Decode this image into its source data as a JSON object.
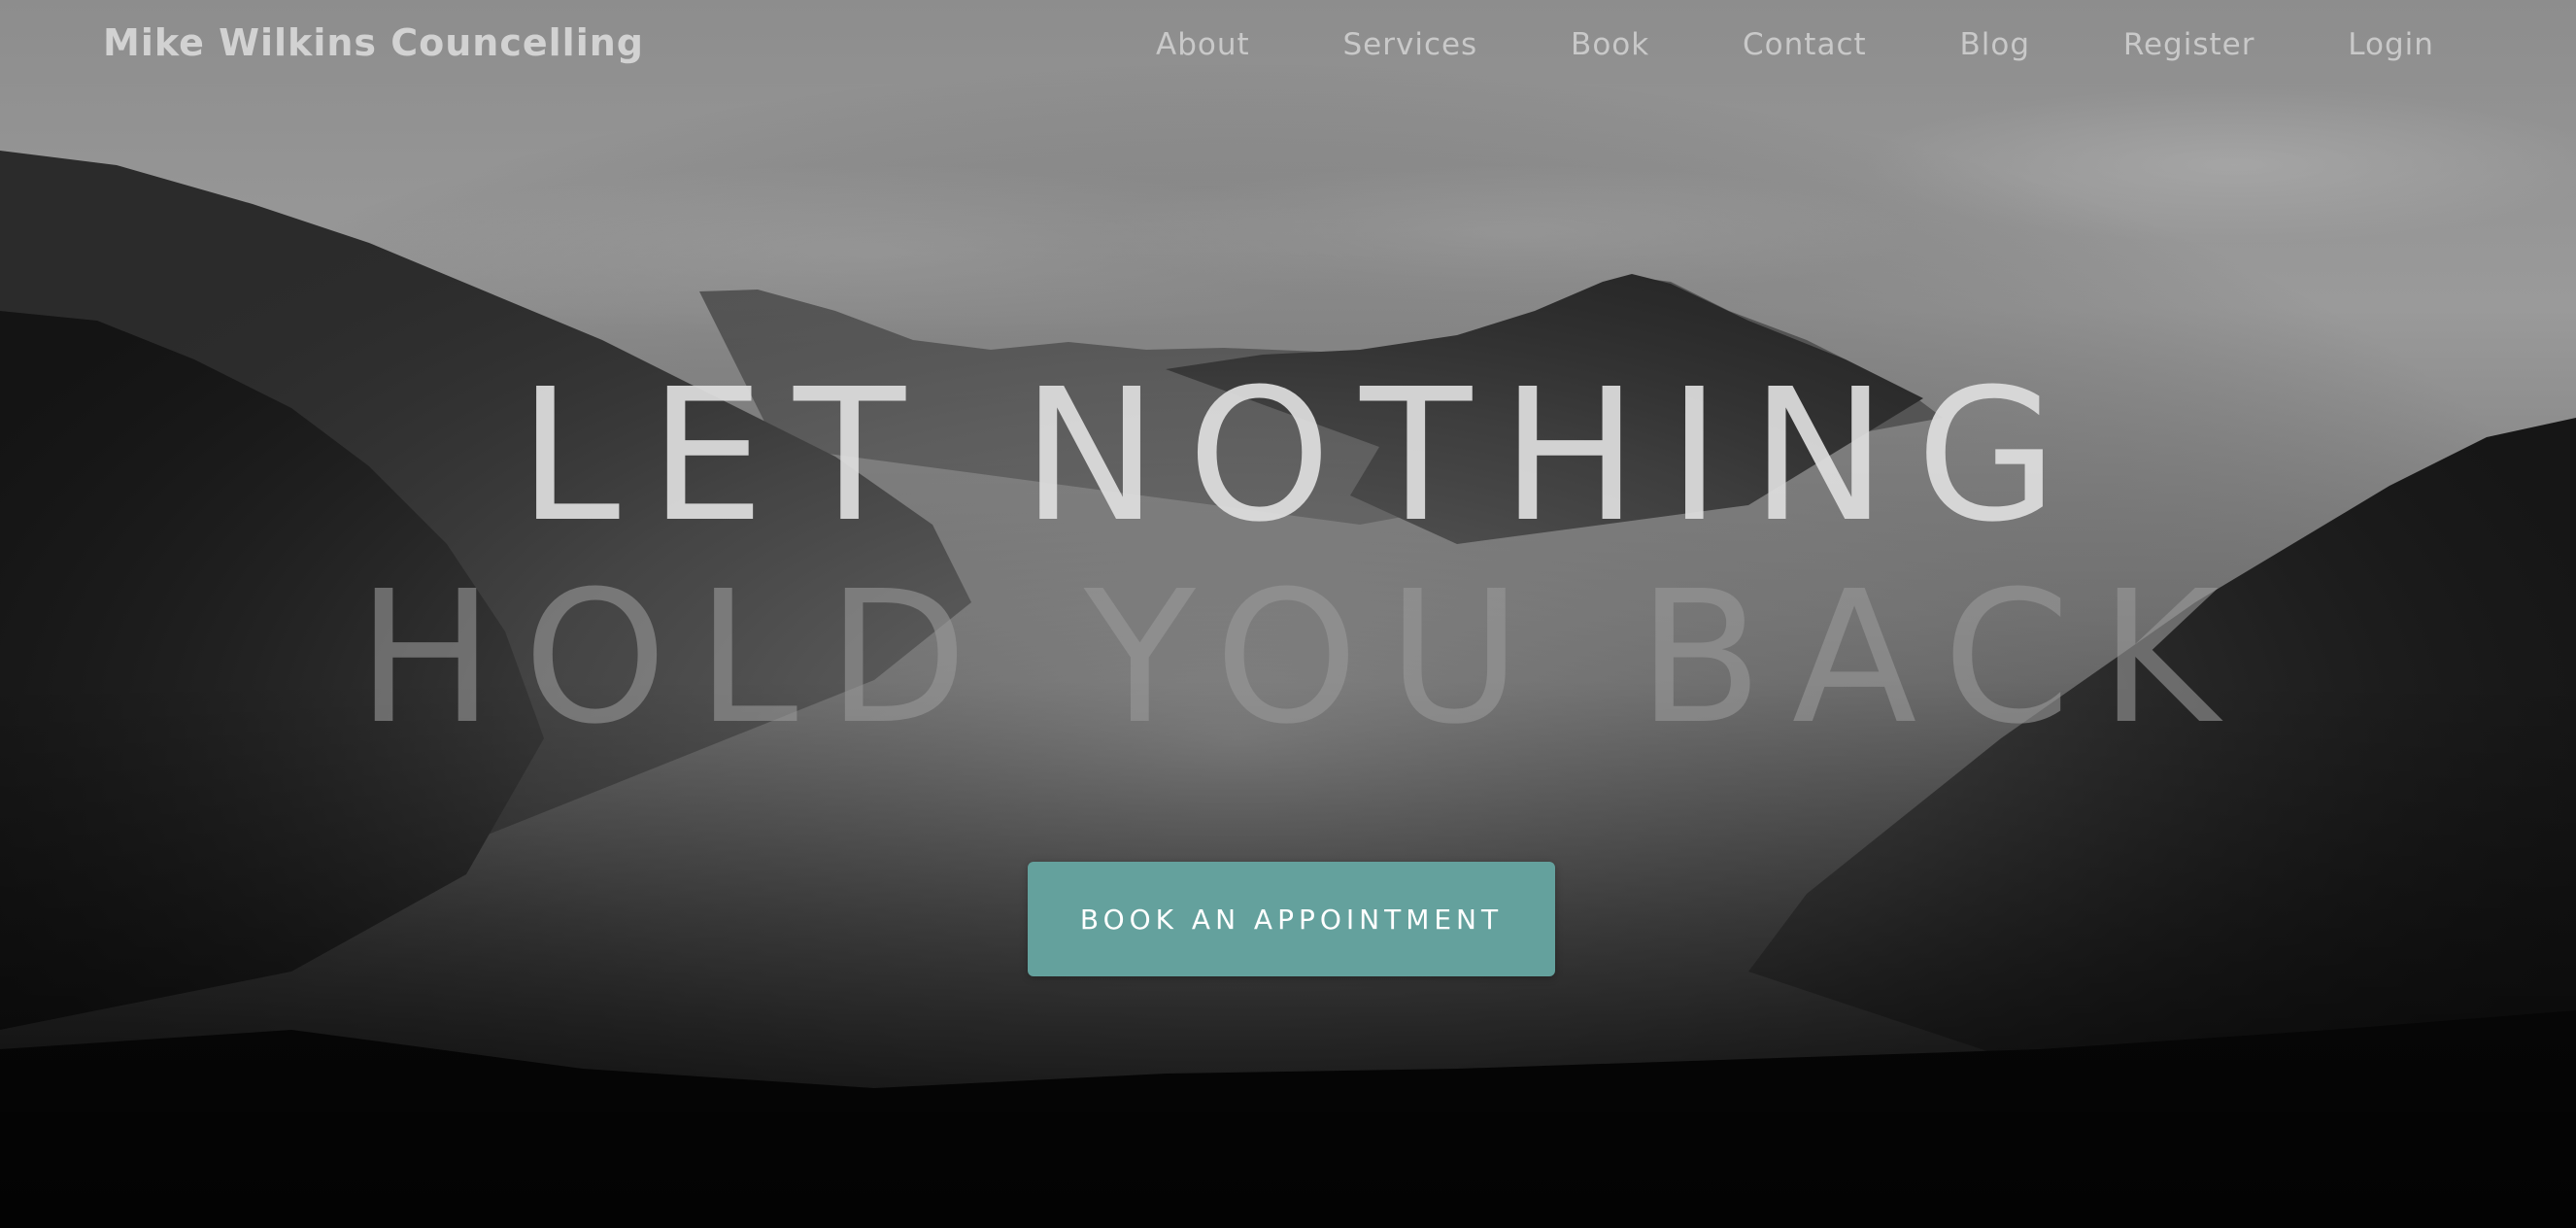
{
  "brand": {
    "name": "Mike Wilkins Councelling"
  },
  "nav": {
    "items": [
      {
        "label": "About"
      },
      {
        "label": "Services"
      },
      {
        "label": "Book"
      },
      {
        "label": "Contact"
      },
      {
        "label": "Blog"
      },
      {
        "label": "Register"
      },
      {
        "label": "Login"
      }
    ]
  },
  "hero": {
    "headline_line1": "LET NOTHING",
    "headline_line2": "HOLD YOU BACK",
    "cta_label": "BOOK AN APPOINTMENT",
    "background": "misty-mountain-forest-photo"
  },
  "colors": {
    "accent": "#64a19d",
    "nav_text": "#c9c9c9",
    "headline_primary": "#dedede",
    "headline_secondary": "#9a9a9a"
  }
}
